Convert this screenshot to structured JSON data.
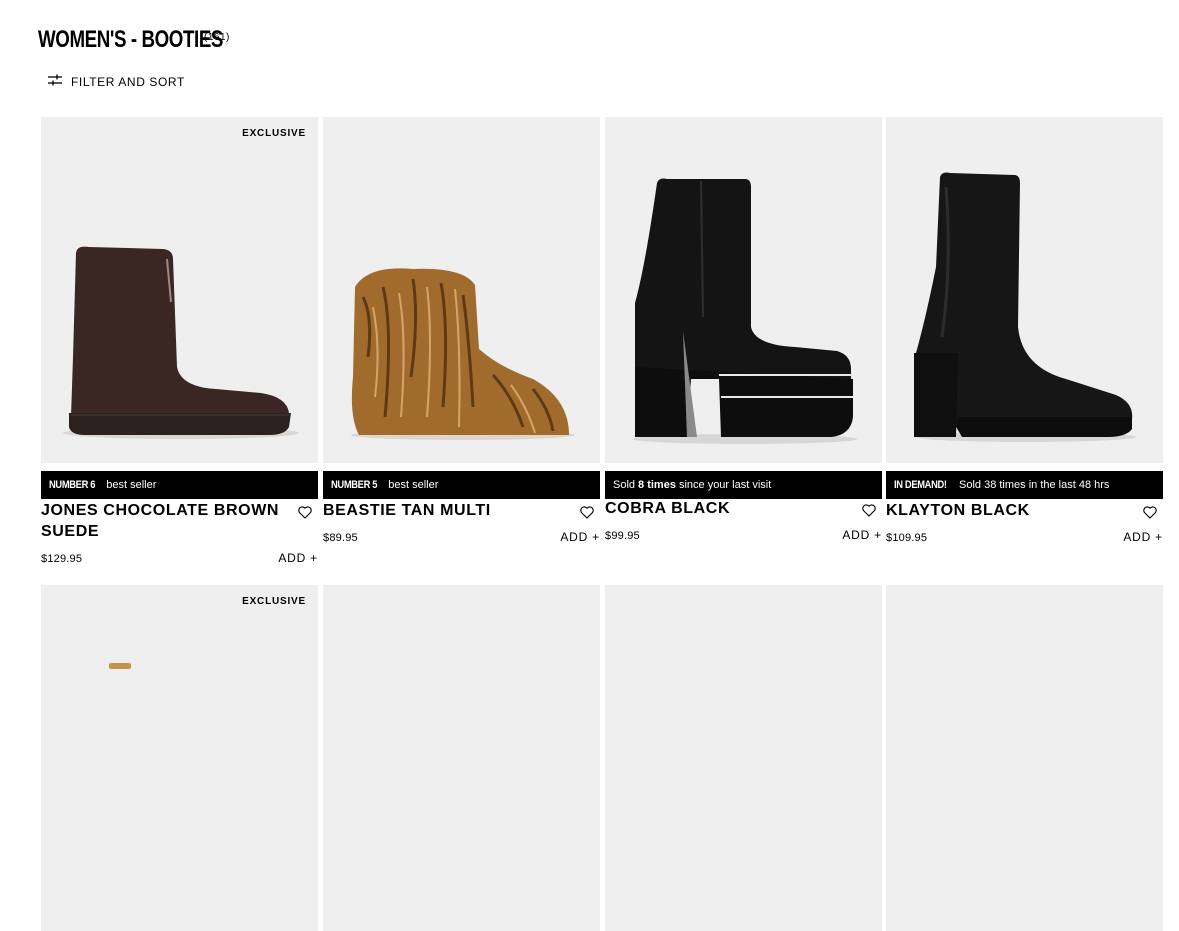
{
  "header": {
    "title": "WOMEN'S - BOOTIES",
    "count": "(161)"
  },
  "filter": {
    "label": "FILTER AND SORT",
    "icon": "sliders-icon"
  },
  "products": [
    {
      "badge": "EXCLUSIVE",
      "promo_lead": "NUMBER 6",
      "promo_text": "best seller",
      "name": "JONES CHOCOLATE BROWN SUEDE",
      "price": "$129.95",
      "add_label": "ADD +",
      "image": "brown suede platform boot"
    },
    {
      "badge": "",
      "promo_lead": "NUMBER 5",
      "promo_text": "best seller",
      "name": "BEASTIE TAN MULTI",
      "price": "$89.95",
      "add_label": "ADD +",
      "image": "tan faux fur boot"
    },
    {
      "badge": "",
      "promo_pre": "Sold",
      "promo_bold": "8 times",
      "promo_post": "since your last visit",
      "name": "COBRA BLACK",
      "price": "$99.95",
      "add_label": "ADD +",
      "image": "black platform heel boot"
    },
    {
      "badge": "",
      "promo_lead": "IN DEMAND!",
      "promo_text": "Sold 38 times in the last 48 hrs",
      "name": "KLAYTON BLACK",
      "price": "$109.95",
      "add_label": "ADD +",
      "image": "black block heel sock boot"
    }
  ],
  "second_row": [
    {
      "badge": "EXCLUSIVE"
    },
    {
      "badge": ""
    },
    {
      "badge": ""
    },
    {
      "badge": ""
    }
  ]
}
